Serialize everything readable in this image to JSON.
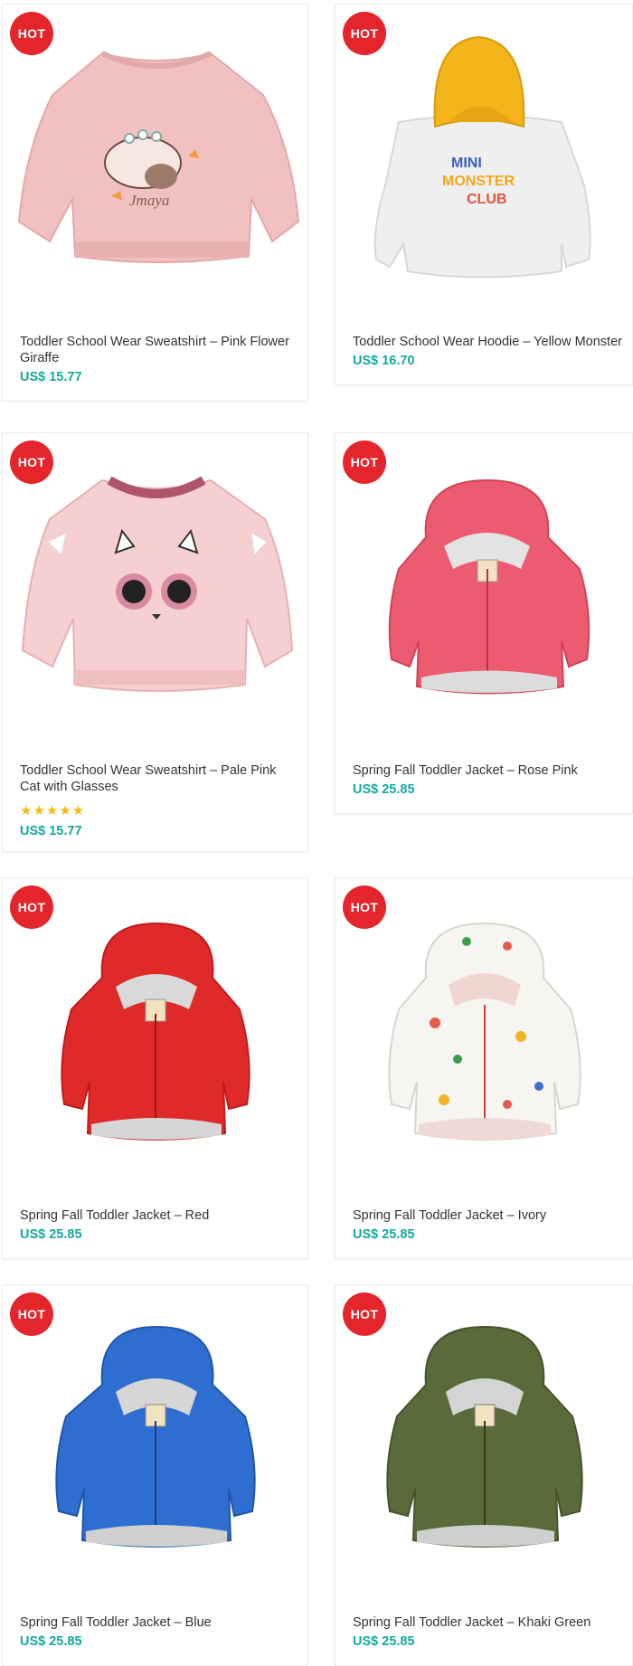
{
  "products": [
    {
      "badge": "HOT",
      "title": "Toddler School Wear Sweatshirt – Pink Flower Giraffe",
      "price": "US$ 15.77"
    },
    {
      "badge": "HOT",
      "title": "Toddler School Wear Hoodie – Yellow Monster",
      "price": "US$ 16.70",
      "graphic_text": "MINI MONSTER CLUB"
    },
    {
      "badge": "HOT",
      "title": "Toddler School Wear Sweatshirt – Pale Pink Cat with Glasses",
      "price": "US$ 15.77",
      "rating_stars": 5,
      "stars_text": "★★★★★"
    },
    {
      "badge": "HOT",
      "title": "Spring Fall Toddler Jacket – Rose Pink",
      "price": "US$ 25.85"
    },
    {
      "badge": "HOT",
      "title": "Spring Fall Toddler Jacket – Red",
      "price": "US$ 25.85"
    },
    {
      "badge": "HOT",
      "title": "Spring Fall Toddler Jacket – Ivory",
      "price": "US$ 25.85"
    },
    {
      "badge": "HOT",
      "title": "Spring Fall Toddler Jacket – Blue",
      "price": "US$ 25.85"
    },
    {
      "badge": "HOT",
      "title": "Spring Fall Toddler Jacket – Khaki Green",
      "price": "US$ 25.85"
    }
  ],
  "colors": {
    "badge": "#e4252b",
    "price": "#12a9a1",
    "star": "#f3b913",
    "title": "#333333"
  }
}
